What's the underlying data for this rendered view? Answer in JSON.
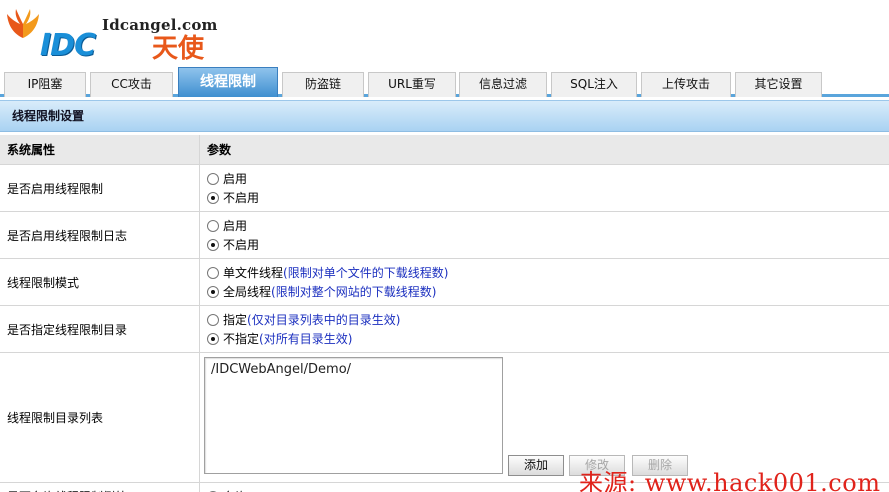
{
  "logo": {
    "domain": "Idcangel.com",
    "brand_latin": "IDC",
    "brand_cn": "天使"
  },
  "tabs": [
    {
      "label": "IP阻塞",
      "active": false
    },
    {
      "label": "CC攻击",
      "active": false
    },
    {
      "label": "线程限制",
      "active": true
    },
    {
      "label": "防盗链",
      "active": false
    },
    {
      "label": "URL重写",
      "active": false
    },
    {
      "label": "信息过滤",
      "active": false
    },
    {
      "label": "SQL注入",
      "active": false
    },
    {
      "label": "上传攻击",
      "active": false
    },
    {
      "label": "其它设置",
      "active": false
    }
  ],
  "section": {
    "title": "线程限制设置"
  },
  "table": {
    "header": {
      "col1": "系统属性",
      "col2": "参数"
    },
    "rows": [
      {
        "label": "是否启用线程限制",
        "options": [
          {
            "text": "启用",
            "hint": "",
            "checked": false
          },
          {
            "text": "不启用",
            "hint": "",
            "checked": true
          }
        ]
      },
      {
        "label": "是否启用线程限制日志",
        "options": [
          {
            "text": "启用",
            "hint": "",
            "checked": false
          },
          {
            "text": "不启用",
            "hint": "",
            "checked": true
          }
        ]
      },
      {
        "label": "线程限制模式",
        "options": [
          {
            "text": "单文件线程",
            "hint": "(限制对单个文件的下载线程数)",
            "checked": false
          },
          {
            "text": "全局线程",
            "hint": "(限制对整个网站的下载线程数)",
            "checked": true
          }
        ]
      },
      {
        "label": "是否指定线程限制目录",
        "options": [
          {
            "text": "指定",
            "hint": "(仅对目录列表中的目录生效)",
            "checked": false
          },
          {
            "text": "不指定",
            "hint": "(对所有目录生效)",
            "checked": true
          }
        ]
      }
    ],
    "dir_list": {
      "label": "线程限制目录列表",
      "value": "/IDCWebAngel/Demo/",
      "add_label": "添加",
      "edit_label": "修改",
      "delete_label": "删除"
    },
    "cut_row": {
      "label": "是否允许线程限制例外",
      "first_option": "允许"
    }
  },
  "watermark": "来源: www.hack001.com",
  "colors": {
    "tab_active": "#3f8fd0",
    "section_bar": "#a9d2f2",
    "hint_text": "#1b2fbf",
    "watermark": "#e0231b"
  }
}
